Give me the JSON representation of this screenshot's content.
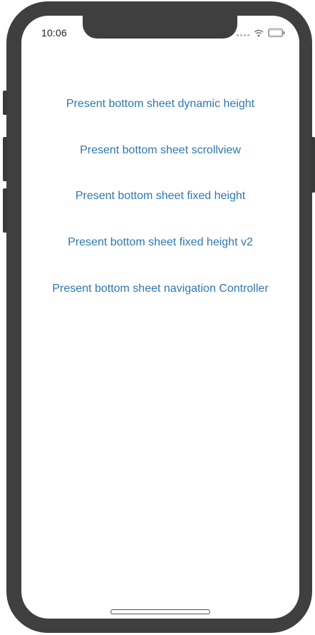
{
  "status_bar": {
    "time": "10:06"
  },
  "icons": {
    "signal": "cellular-signal-icon",
    "wifi": "wifi-icon",
    "battery": "battery-icon"
  },
  "menu": {
    "items": [
      {
        "label": "Present bottom sheet dynamic height"
      },
      {
        "label": "Present bottom sheet scrollview"
      },
      {
        "label": "Present bottom sheet fixed height"
      },
      {
        "label": "Present bottom sheet fixed height v2"
      },
      {
        "label": "Present bottom sheet navigation Controller"
      }
    ]
  },
  "colors": {
    "link": "#2f77b0",
    "frame": "#3f3f3f",
    "background": "#ffffff"
  }
}
